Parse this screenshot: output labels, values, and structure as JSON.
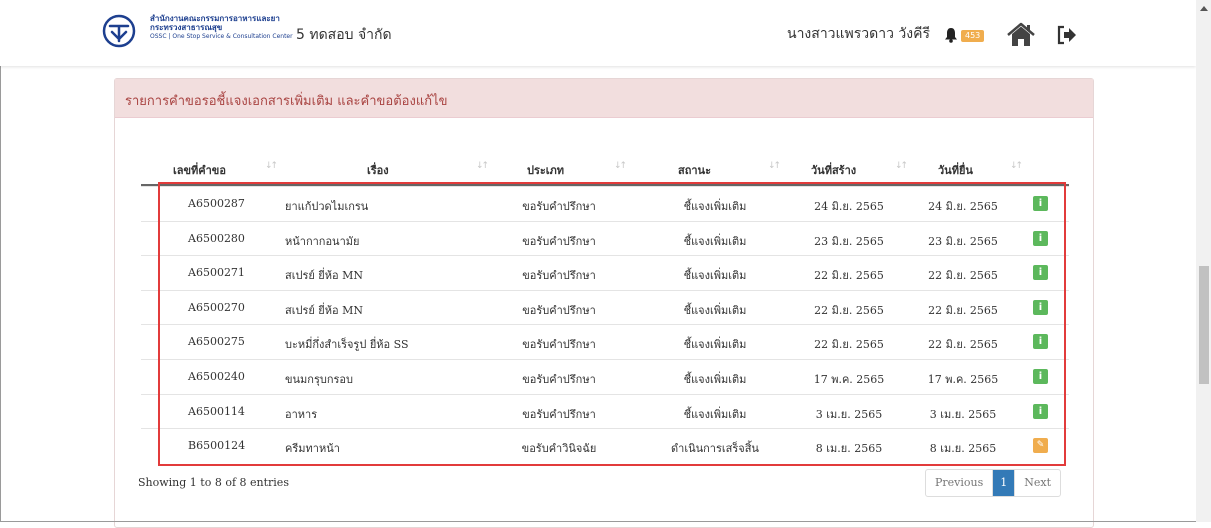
{
  "header": {
    "logo_line1": "สำนักงานคณะกรรมการอาหารและยา",
    "logo_line2": "กระทรวงสาธารณสุข",
    "logo_line3": "OSSC | One Stop Service & Consultation Center",
    "company": "5 ทดสอบ จำกัด",
    "username": "นางสาวแพรวดาว วังคีรี",
    "notification_count": "453",
    "icons": [
      "bell-icon",
      "home-icon",
      "logout-icon"
    ]
  },
  "panel": {
    "title": "รายการคำขอรอชี้แจงเอกสารเพิ่มเติม และคำขอต้องแก้ไข"
  },
  "table": {
    "columns": [
      "เลขที่คำขอ",
      "เรื่อง",
      "ประเภท",
      "สถานะ",
      "วันที่สร้าง",
      "วันที่ยื่น"
    ],
    "rows": [
      {
        "id": "A6500287",
        "subject": "ยาแก้ปวดไมเกรน",
        "type": "ขอรับคำปรึกษา",
        "status": "ชี้แจงเพิ่มเติม",
        "created": "24 มิ.ย. 2565",
        "submitted": "24 มิ.ย. 2565",
        "action": "info"
      },
      {
        "id": "A6500280",
        "subject": "หน้ากากอนามัย",
        "type": "ขอรับคำปรึกษา",
        "status": "ชี้แจงเพิ่มเติม",
        "created": "23 มิ.ย. 2565",
        "submitted": "23 มิ.ย. 2565",
        "action": "info"
      },
      {
        "id": "A6500271",
        "subject": "สเปรย์ ยี่ห้อ MN",
        "type": "ขอรับคำปรึกษา",
        "status": "ชี้แจงเพิ่มเติม",
        "created": "22 มิ.ย. 2565",
        "submitted": "22 มิ.ย. 2565",
        "action": "info"
      },
      {
        "id": "A6500270",
        "subject": "สเปรย์ ยี่ห้อ MN",
        "type": "ขอรับคำปรึกษา",
        "status": "ชี้แจงเพิ่มเติม",
        "created": "22 มิ.ย. 2565",
        "submitted": "22 มิ.ย. 2565",
        "action": "info"
      },
      {
        "id": "A6500275",
        "subject": "บะหมี่กึ่งสำเร็จรูป ยี่ห้อ SS",
        "type": "ขอรับคำปรึกษา",
        "status": "ชี้แจงเพิ่มเติม",
        "created": "22 มิ.ย. 2565",
        "submitted": "22 มิ.ย. 2565",
        "action": "info"
      },
      {
        "id": "A6500240",
        "subject": "ขนมกรุบกรอบ",
        "type": "ขอรับคำปรึกษา",
        "status": "ชี้แจงเพิ่มเติม",
        "created": "17 พ.ค. 2565",
        "submitted": "17 พ.ค. 2565",
        "action": "info"
      },
      {
        "id": "A6500114",
        "subject": "อาหาร",
        "type": "ขอรับคำปรึกษา",
        "status": "ชี้แจงเพิ่มเติม",
        "created": "3 เม.ย. 2565",
        "submitted": "3 เม.ย. 2565",
        "action": "info"
      },
      {
        "id": "B6500124",
        "subject": "ครีมทาหน้า",
        "type": "ขอรับคำวินิจฉัย",
        "status": "ดำเนินการเสร็จสิ้น",
        "created": "8 เม.ย. 2565",
        "submitted": "8 เม.ย. 2565",
        "action": "edit"
      }
    ]
  },
  "footer": {
    "info": "Showing 1 to 8 of 8 entries",
    "prev": "Previous",
    "page": "1",
    "next": "Next"
  },
  "colors": {
    "panel_heading_bg": "#f2dede",
    "panel_title": "#a94442",
    "info_button": "#5cb85c",
    "edit_button": "#f0ad4e",
    "active_page": "#337ab7",
    "highlight_box": "#e23b3b"
  }
}
